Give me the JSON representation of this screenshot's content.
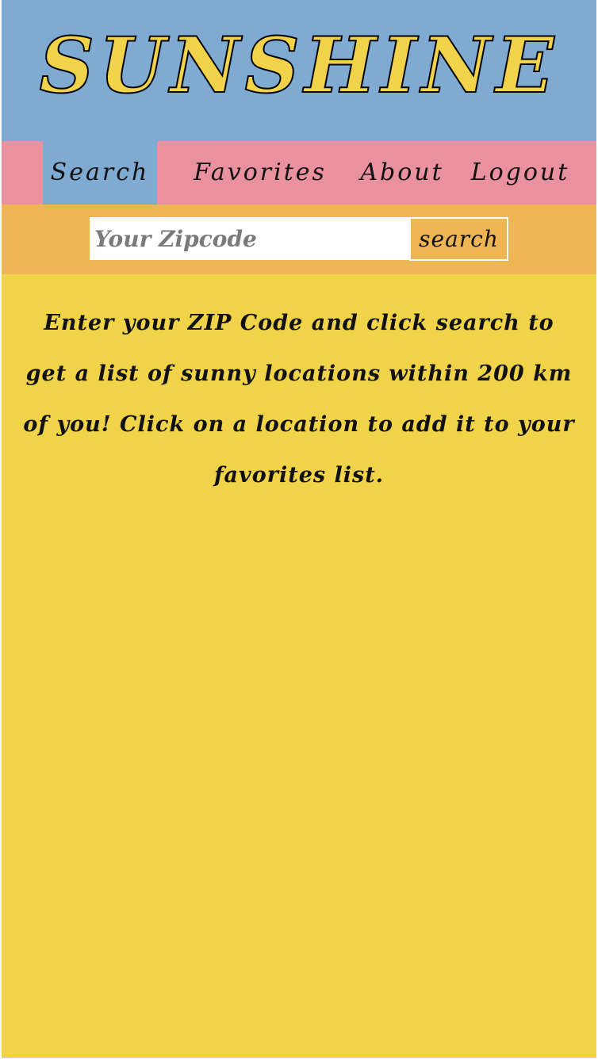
{
  "header": {
    "logo": "SUNSHINE"
  },
  "nav": {
    "items": [
      {
        "label": "Search",
        "active": true
      },
      {
        "label": "Favorites",
        "active": false
      },
      {
        "label": "About",
        "active": false
      },
      {
        "label": "Logout",
        "active": false
      }
    ]
  },
  "search": {
    "placeholder": "Your Zipcode",
    "value": "",
    "button_label": "search"
  },
  "main": {
    "instructions": "Enter your ZIP Code and click search to get a list of sunny locations within 200 km of you! Click on a location to add it to your favorites list."
  },
  "colors": {
    "header_bg": "#7faad2",
    "logo_fill": "#f0d348",
    "nav_bg": "#e9919f",
    "nav_active_bg": "#7faad2",
    "search_bar_bg": "#edb553",
    "content_bg": "#f0d348"
  }
}
